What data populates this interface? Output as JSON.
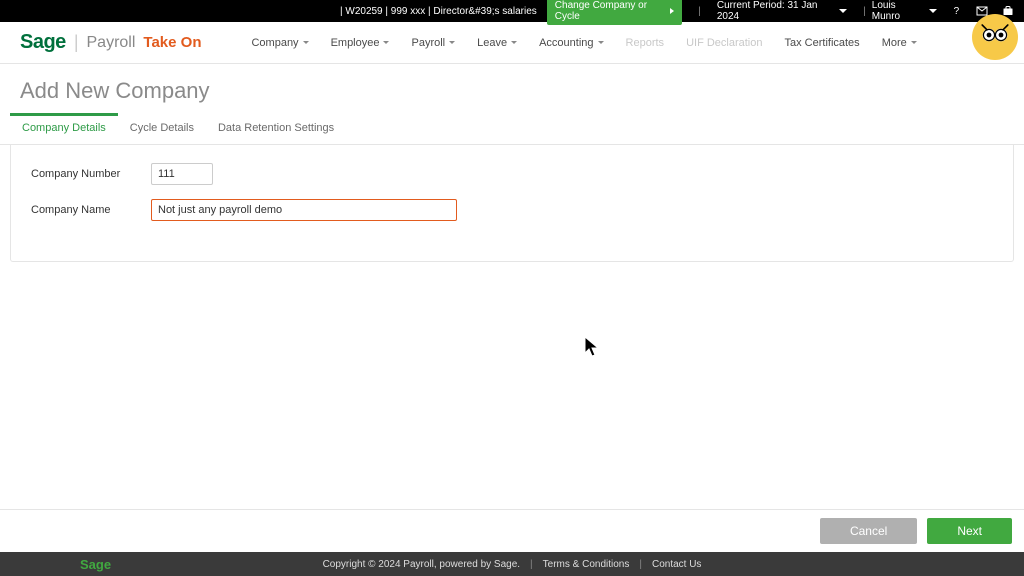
{
  "topbar": {
    "context": "| W20259 | 999 xxx | Director&#39;s salaries",
    "change_btn": "Change Company or Cycle",
    "period_label": "Current Period: 31 Jan 2024",
    "user_name": "Louis Munro"
  },
  "brand": {
    "sage": "Sage",
    "payroll": "Payroll",
    "takeon": "Take On"
  },
  "mainnav": {
    "company": "Company",
    "employee": "Employee",
    "payroll": "Payroll",
    "leave": "Leave",
    "accounting": "Accounting",
    "reports": "Reports",
    "uif": "UIF Declaration",
    "tax": "Tax Certificates",
    "more": "More"
  },
  "page": {
    "title": "Add New Company"
  },
  "tabs": {
    "t1": "Company Details",
    "t2": "Cycle Details",
    "t3": "Data Retention Settings"
  },
  "form": {
    "company_number_label": "Company Number",
    "company_number_value": "111",
    "company_name_label": "Company Name",
    "company_name_value": "Not just any payroll demo"
  },
  "actions": {
    "cancel": "Cancel",
    "next": "Next"
  },
  "footer": {
    "sage": "Sage",
    "copyright": "Copyright © 2024 Payroll, powered by Sage.",
    "terms": "Terms & Conditions",
    "contact": "Contact Us"
  }
}
